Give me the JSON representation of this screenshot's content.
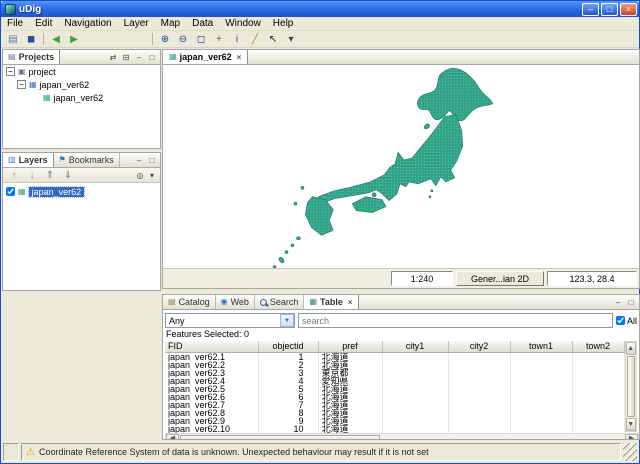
{
  "window": {
    "title": "uDig"
  },
  "menu": {
    "items": [
      "File",
      "Edit",
      "Navigation",
      "Layer",
      "Map",
      "Data",
      "Window",
      "Help"
    ]
  },
  "toolbar": {
    "buttons": [
      {
        "name": "new-map-icon",
        "glyph": "▤",
        "color": "#5b7bb8"
      },
      {
        "name": "save-icon",
        "glyph": "◼",
        "color": "#2a4d9b"
      },
      {
        "name": "separator"
      },
      {
        "name": "back-icon",
        "glyph": "◀",
        "color": "#3fa045"
      },
      {
        "name": "forward-icon",
        "glyph": "▶",
        "color": "#3fa045"
      },
      {
        "name": "spacer"
      },
      {
        "name": "separator"
      },
      {
        "name": "zoom-in-icon",
        "glyph": "⊕",
        "color": "#1c3f94"
      },
      {
        "name": "zoom-out-icon",
        "glyph": "⊖",
        "color": "#1c3f94"
      },
      {
        "name": "zoom-extent-icon",
        "glyph": "◻",
        "color": "#1c3f94"
      },
      {
        "name": "pan-tool-icon",
        "glyph": "+",
        "color": "#8a5a1e"
      },
      {
        "name": "info-tool-icon",
        "glyph": "i",
        "color": "#1553c4"
      },
      {
        "name": "measure-tool-icon",
        "glyph": "╱",
        "color": "#b89018"
      },
      {
        "name": "select-tool-icon",
        "glyph": "↖",
        "color": "#222222"
      },
      {
        "name": "tool-dropdown-icon",
        "glyph": "▾",
        "color": "#444444"
      }
    ]
  },
  "projects_view": {
    "tab": "Projects",
    "toolbar": [
      {
        "name": "link-editor-icon",
        "glyph": "⇄",
        "color": "#777777"
      },
      {
        "name": "collapse-all-icon",
        "glyph": "⊟",
        "color": "#777777"
      }
    ],
    "tree": [
      {
        "label": "project"
      },
      {
        "label": "japan_ver62"
      },
      {
        "label": "japan_ver62"
      }
    ]
  },
  "layers_view": {
    "tabs": [
      "Layers",
      "Bookmarks"
    ],
    "toolbar": [
      {
        "name": "move-layer-up-icon",
        "glyph": "↑",
        "color": "#c98a00"
      },
      {
        "name": "move-layer-down-icon",
        "glyph": "↓",
        "color": "#c98a00"
      },
      {
        "name": "layer-front-icon",
        "glyph": "⇑",
        "color": "#777777"
      },
      {
        "name": "layer-back-icon",
        "glyph": "⇓",
        "color": "#777777"
      }
    ],
    "layer": {
      "label": "japan_ver62",
      "checked": true
    }
  },
  "editor": {
    "tab_label": "japan_ver62",
    "scale": "1:240",
    "crs_label": "Gener...ian 2D",
    "coords": "123.3, 28.4"
  },
  "bottom_panel": {
    "tabs": [
      "Catalog",
      "Web",
      "Search",
      "Table"
    ],
    "active_tab": "Table",
    "filter": {
      "attribute": "Any",
      "search_placeholder": "search",
      "all_label": "All",
      "all_checked": true
    },
    "features_label": "Features Selected: 0",
    "table": {
      "columns": [
        "FID",
        "objectid",
        "pref",
        "city1",
        "city2",
        "town1",
        "town2"
      ],
      "rows": [
        [
          "japan_ver62.1",
          "1",
          "北海道",
          "",
          "",
          "",
          ""
        ],
        [
          "japan_ver62.2",
          "2",
          "北海道",
          "",
          "",
          "",
          ""
        ],
        [
          "japan_ver62.3",
          "3",
          "東京都",
          "",
          "",
          "",
          ""
        ],
        [
          "japan_ver62.4",
          "4",
          "愛知県",
          "",
          "",
          "",
          ""
        ],
        [
          "japan_ver62.5",
          "5",
          "北海道",
          "",
          "",
          "",
          ""
        ],
        [
          "japan_ver62.6",
          "6",
          "北海道",
          "",
          "",
          "",
          ""
        ],
        [
          "japan_ver62.7",
          "7",
          "北海道",
          "",
          "",
          "",
          ""
        ],
        [
          "japan_ver62.8",
          "8",
          "北海道",
          "",
          "",
          "",
          ""
        ],
        [
          "japan_ver62.9",
          "9",
          "北海道",
          "",
          "",
          "",
          ""
        ],
        [
          "japan_ver62.10",
          "10",
          "北海道",
          "",
          "",
          "",
          ""
        ]
      ]
    }
  },
  "status_bar": {
    "message": "Coordinate Reference System of data is unknown. Unexpected behaviour may result if it is not set"
  },
  "icons": {
    "win_min": "–",
    "win_max": "□",
    "win_close": "×",
    "view_min": "–",
    "view_max": "□",
    "tab_close": "×",
    "combo_arrow": "▼",
    "warning": "⚠",
    "expander": "−",
    "project": "▣",
    "map": "▦",
    "layer": "▦",
    "layers_tab": "▥",
    "bookmarks_tab": "⚑",
    "projects_tab": "▤",
    "catalog_tab": "▤",
    "web_tab": "◉",
    "table_tab": "▦",
    "editor_tab": "▦",
    "scroll_up": "▲",
    "scroll_down": "▼",
    "scroll_left": "◀",
    "scroll_right": "▶",
    "view_menu": "▾",
    "zoom_to_layer": "◎"
  },
  "colors": {
    "map_fill": "#2FA287",
    "map_stroke": "#137A60",
    "selection": "#316AC5",
    "titlebar": "#2E6FE8"
  }
}
